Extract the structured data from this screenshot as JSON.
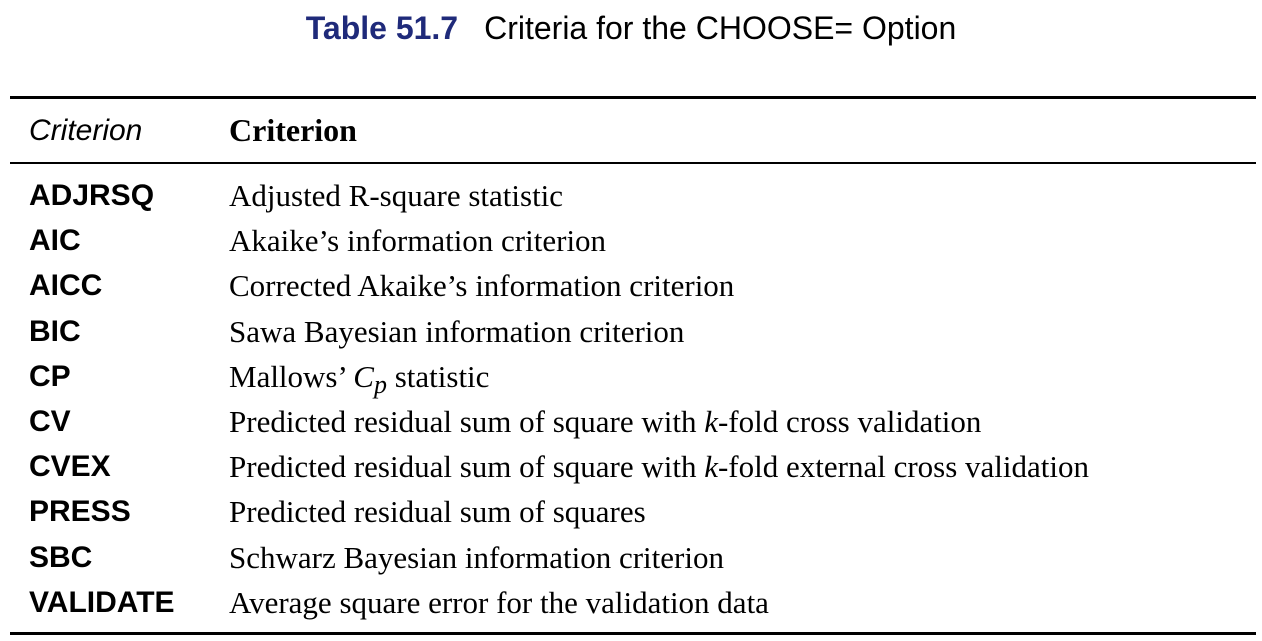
{
  "caption": {
    "label": "Table 51.7",
    "title": "Criteria for the CHOOSE= Option"
  },
  "table": {
    "headers": [
      "Criterion",
      "Criterion"
    ],
    "rows": [
      {
        "key": "ADJRSQ",
        "desc_parts": [
          {
            "t": "Adjusted R-square statistic",
            "s": "plain"
          }
        ]
      },
      {
        "key": "AIC",
        "desc_parts": [
          {
            "t": "Akaike’s information criterion",
            "s": "plain"
          }
        ]
      },
      {
        "key": "AICC",
        "desc_parts": [
          {
            "t": "Corrected Akaike’s information criterion",
            "s": "plain"
          }
        ]
      },
      {
        "key": "BIC",
        "desc_parts": [
          {
            "t": "Sawa Bayesian information criterion",
            "s": "plain"
          }
        ]
      },
      {
        "key": "CP",
        "desc_parts": [
          {
            "t": "Mallows’ ",
            "s": "plain"
          },
          {
            "t": "C",
            "s": "math"
          },
          {
            "t": "p",
            "s": "sub"
          },
          {
            "t": " statistic",
            "s": "plain"
          }
        ]
      },
      {
        "key": "CV",
        "desc_parts": [
          {
            "t": "Predicted residual sum of square with ",
            "s": "plain"
          },
          {
            "t": "k",
            "s": "math"
          },
          {
            "t": "-fold cross validation",
            "s": "plain"
          }
        ]
      },
      {
        "key": "CVEX",
        "desc_parts": [
          {
            "t": "Predicted residual sum of square with ",
            "s": "plain"
          },
          {
            "t": "k",
            "s": "math"
          },
          {
            "t": "-fold external cross validation",
            "s": "plain"
          }
        ]
      },
      {
        "key": "PRESS",
        "desc_parts": [
          {
            "t": "Predicted residual sum of squares",
            "s": "plain"
          }
        ]
      },
      {
        "key": "SBC",
        "desc_parts": [
          {
            "t": "Schwarz Bayesian information criterion",
            "s": "plain"
          }
        ]
      },
      {
        "key": "VALIDATE",
        "desc_parts": [
          {
            "t": "Average square error for the validation data",
            "s": "plain"
          }
        ]
      }
    ]
  }
}
